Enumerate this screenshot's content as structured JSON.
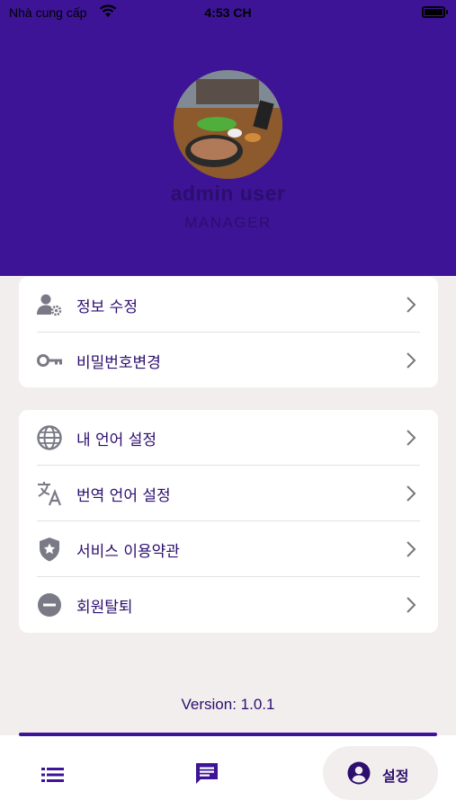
{
  "status_bar": {
    "carrier": "Nhà cung cấp",
    "time": "4:53 CH"
  },
  "profile": {
    "name": "admin user",
    "role": "MANAGER"
  },
  "account_menu": [
    {
      "label": "정보 수정",
      "icon": "user-gear-icon"
    },
    {
      "label": "비밀번호변경",
      "icon": "key-icon"
    }
  ],
  "settings_menu": [
    {
      "label": "내 언어 설정",
      "icon": "globe-icon"
    },
    {
      "label": "번역 언어 설정",
      "icon": "translate-icon"
    },
    {
      "label": "서비스 이용약관",
      "icon": "shield-star-icon"
    },
    {
      "label": "회원탈퇴",
      "icon": "minus-circle-icon"
    }
  ],
  "version": "Version: 1.0.1",
  "bottom_nav": {
    "settings_label": "설정"
  },
  "colors": {
    "header": "#3d1496",
    "text": "#2c0e6e",
    "background": "#f3eeee"
  }
}
